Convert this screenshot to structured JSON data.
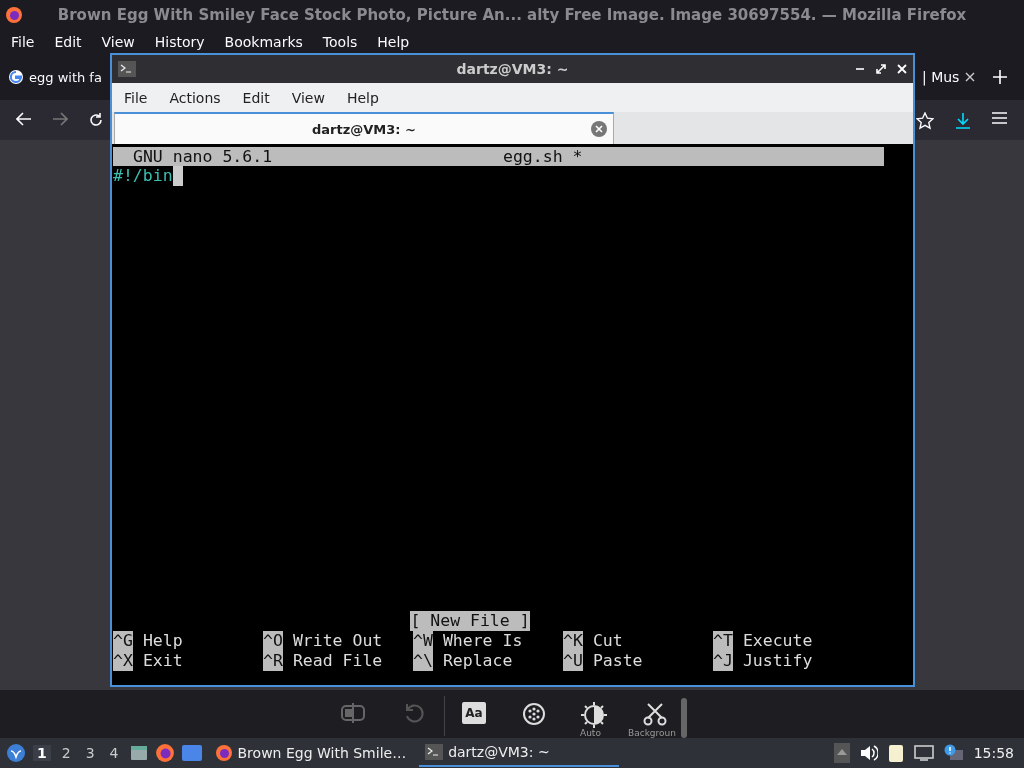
{
  "browser": {
    "title": "Brown Egg With Smiley Face Stock Photo, Picture An... alty Free Image. Image 30697554. — Mozilla Firefox",
    "menu": [
      "File",
      "Edit",
      "View",
      "History",
      "Bookmarks",
      "Tools",
      "Help"
    ],
    "tabs": [
      {
        "label": "egg with fa",
        "selected": false
      },
      {
        "label": "| Mus",
        "selected": false
      }
    ],
    "font_button": "Aa",
    "toolbar_labels": [
      "Auto",
      "Backgroun"
    ]
  },
  "terminal": {
    "title": "dartz@VM3: ~",
    "menu": [
      "File",
      "Actions",
      "Edit",
      "View",
      "Help"
    ],
    "tabs": [
      {
        "label": "dartz@VM3: ~",
        "selected": true
      }
    ],
    "nano": {
      "version": "GNU nano 5.6.1",
      "filename": "egg.sh *",
      "lines": [
        "#!/bin"
      ],
      "status": "[ New File ]",
      "shortcuts": [
        {
          "key": "^G",
          "label": "Help"
        },
        {
          "key": "^O",
          "label": "Write Out"
        },
        {
          "key": "^W",
          "label": "Where Is"
        },
        {
          "key": "^K",
          "label": "Cut"
        },
        {
          "key": "^T",
          "label": "Execute"
        },
        {
          "key": "^X",
          "label": "Exit"
        },
        {
          "key": "^R",
          "label": "Read File"
        },
        {
          "key": "^\\",
          "label": "Replace"
        },
        {
          "key": "^U",
          "label": "Paste"
        },
        {
          "key": "^J",
          "label": "Justify"
        }
      ]
    }
  },
  "taskbar": {
    "workspaces": [
      {
        "label": "1",
        "selected": true
      },
      {
        "label": "2",
        "selected": false
      },
      {
        "label": "3",
        "selected": false
      },
      {
        "label": "4",
        "selected": false
      }
    ],
    "tasks": [
      {
        "label": "Brown Egg With Smile…",
        "selected": false
      },
      {
        "label": "dartz@VM3: ~",
        "selected": true
      }
    ],
    "clock": "15:58"
  }
}
